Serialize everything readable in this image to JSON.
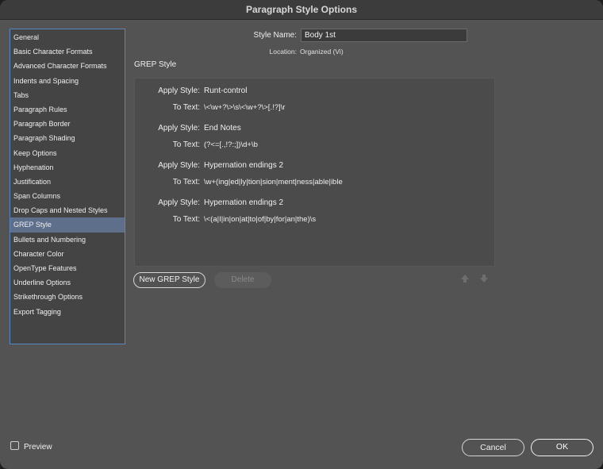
{
  "window": {
    "title": "Paragraph Style Options"
  },
  "sidebar": {
    "selected_index": 13,
    "items": [
      "General",
      "Basic Character Formats",
      "Advanced Character Formats",
      "Indents and Spacing",
      "Tabs",
      "Paragraph Rules",
      "Paragraph Border",
      "Paragraph Shading",
      "Keep Options",
      "Hyphenation",
      "Justification",
      "Span Columns",
      "Drop Caps and Nested Styles",
      "GREP Style",
      "Bullets and Numbering",
      "Character Color",
      "OpenType Features",
      "Underline Options",
      "Strikethrough Options",
      "Export Tagging"
    ]
  },
  "header": {
    "style_name_label": "Style Name:",
    "style_name_value": "Body 1st",
    "location_label": "Location:",
    "location_value": "Organized (Vi)"
  },
  "main": {
    "section_title": "GREP Style",
    "apply_label": "Apply Style:",
    "text_label": "To Text:",
    "rules": [
      {
        "style": "Runt-control",
        "text": "\\<\\w+?\\>\\s\\<\\w+?\\>[.!?]\\r"
      },
      {
        "style": "End Notes",
        "text": "(?<=[.,!?:;])\\d+\\b"
      },
      {
        "style": "Hypernation endings 2",
        "text": "\\w+(ing|ed|ly|tion|sion|ment|ness|able|ible"
      },
      {
        "style": "Hypernation endings 2",
        "text": "\\<(a|I|in|on|at|to|of|by|for|an|the)\\s"
      }
    ]
  },
  "buttons": {
    "new_grep_style": "New GREP Style",
    "delete": "Delete",
    "preview": "Preview",
    "cancel": "Cancel",
    "ok": "OK"
  },
  "colors": {
    "window_bg": "#535353",
    "selection": "#5d6f8a",
    "focus_border": "#5a86c0"
  }
}
